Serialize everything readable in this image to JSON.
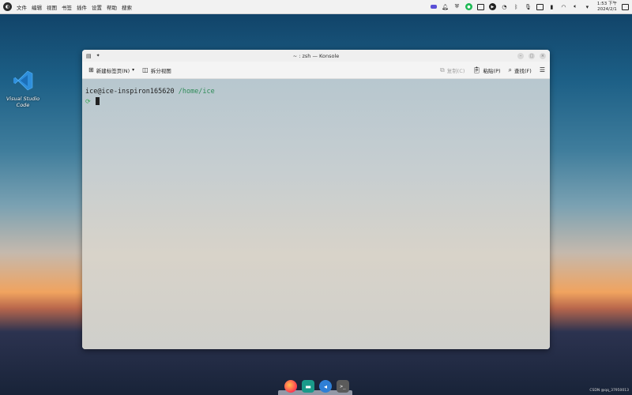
{
  "topbar": {
    "menu": [
      "文件",
      "编辑",
      "视图",
      "书签",
      "插件",
      "设置",
      "帮助",
      "搜索"
    ],
    "clock_time": "1:53 下午",
    "clock_date": "2024/2/1"
  },
  "desktop": {
    "icon_label": "Visual Studio Code"
  },
  "window": {
    "title": "~ : zsh — Konsole",
    "toolbar": {
      "new_tab": "新建标签页(N)",
      "split_view": "拆分视图",
      "copy": "复制(C)",
      "paste": "粘贴(P)",
      "find": "查找(F)"
    },
    "terminal": {
      "user_host": "ice@ice-inspiron165620",
      "path": "/home/ice"
    }
  },
  "watermark": "CSDN @qq_37950013",
  "colors": {
    "prompt_path": "#2e8b57",
    "firefox": "#ff3750",
    "files": "#1a9a8a"
  }
}
